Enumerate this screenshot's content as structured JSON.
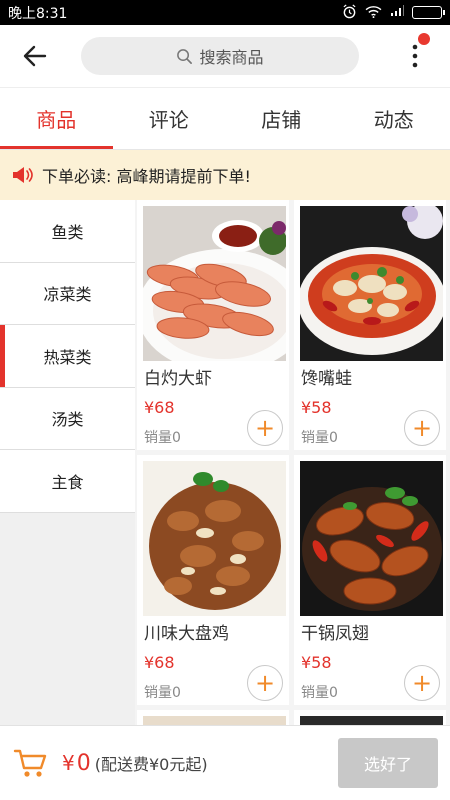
{
  "status_bar": {
    "time": "晚上8:31",
    "icons": [
      "alarm-icon",
      "wifi-icon",
      "signal-icon",
      "battery-icon"
    ]
  },
  "header": {
    "search_placeholder": "搜索商品",
    "back_icon": "arrow-left-icon",
    "more_icon": "more-vertical-icon"
  },
  "tabs": [
    {
      "label": "商品",
      "active": true
    },
    {
      "label": "评论",
      "active": false
    },
    {
      "label": "店铺",
      "active": false
    },
    {
      "label": "动态",
      "active": false
    }
  ],
  "notice": {
    "icon": "megaphone-icon",
    "text": "下单必读: 高峰期请提前下单!"
  },
  "categories": [
    {
      "label": "鱼类",
      "active": false
    },
    {
      "label": "凉菜类",
      "active": false
    },
    {
      "label": "热菜类",
      "active": true
    },
    {
      "label": "汤类",
      "active": false
    },
    {
      "label": "主食",
      "active": false
    }
  ],
  "products": [
    {
      "name": "白灼大虾",
      "price": "¥68",
      "sales": "销量0"
    },
    {
      "name": "馋嘴蛙",
      "price": "¥58",
      "sales": "销量0"
    },
    {
      "name": "川味大盘鸡",
      "price": "¥68",
      "sales": "销量0"
    },
    {
      "name": "干锅凤翅",
      "price": "¥58",
      "sales": "销量0"
    }
  ],
  "add_symbol": "+",
  "footer": {
    "currency": "¥",
    "amount": "0",
    "delivery_note": "(配送费¥0元起)",
    "submit_label": "选好了"
  },
  "colors": {
    "accent": "#e3332c",
    "notice_bg": "#fcf1d6",
    "cart_orange": "#f08a2a",
    "button_disabled": "#c8c8c8"
  }
}
